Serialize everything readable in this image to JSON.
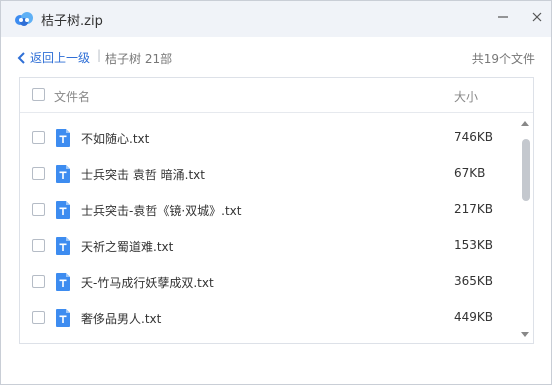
{
  "window": {
    "title": "桔子树.zip",
    "app_icon": "cloud-icon",
    "minimize_icon": "minimize-icon",
    "close_icon": "close-icon"
  },
  "nav": {
    "back_label": "返回上一级",
    "separator": "|",
    "folder_label": "桔子树 21部",
    "file_count": "共19个文件"
  },
  "list": {
    "header_name": "文件名",
    "header_size": "大小",
    "files": [
      {
        "name": "不如随心.txt",
        "size": "746KB",
        "icon": "txt-file-icon"
      },
      {
        "name": "士兵突击 袁哲 暗涌.txt",
        "size": "67KB",
        "icon": "txt-file-icon"
      },
      {
        "name": "士兵突击-袁哲《镜·双城》.txt",
        "size": "217KB",
        "icon": "txt-file-icon"
      },
      {
        "name": "天祈之蜀道难.txt",
        "size": "153KB",
        "icon": "txt-file-icon"
      },
      {
        "name": "夭-竹马成行妖孽成双.txt",
        "size": "365KB",
        "icon": "txt-file-icon"
      },
      {
        "name": "奢侈品男人.txt",
        "size": "449KB",
        "icon": "txt-file-icon"
      }
    ]
  },
  "colors": {
    "accent": "#2f6fd6",
    "file_icon": "#3d8cf0",
    "titlebar_bg": "#f0f3f8"
  }
}
